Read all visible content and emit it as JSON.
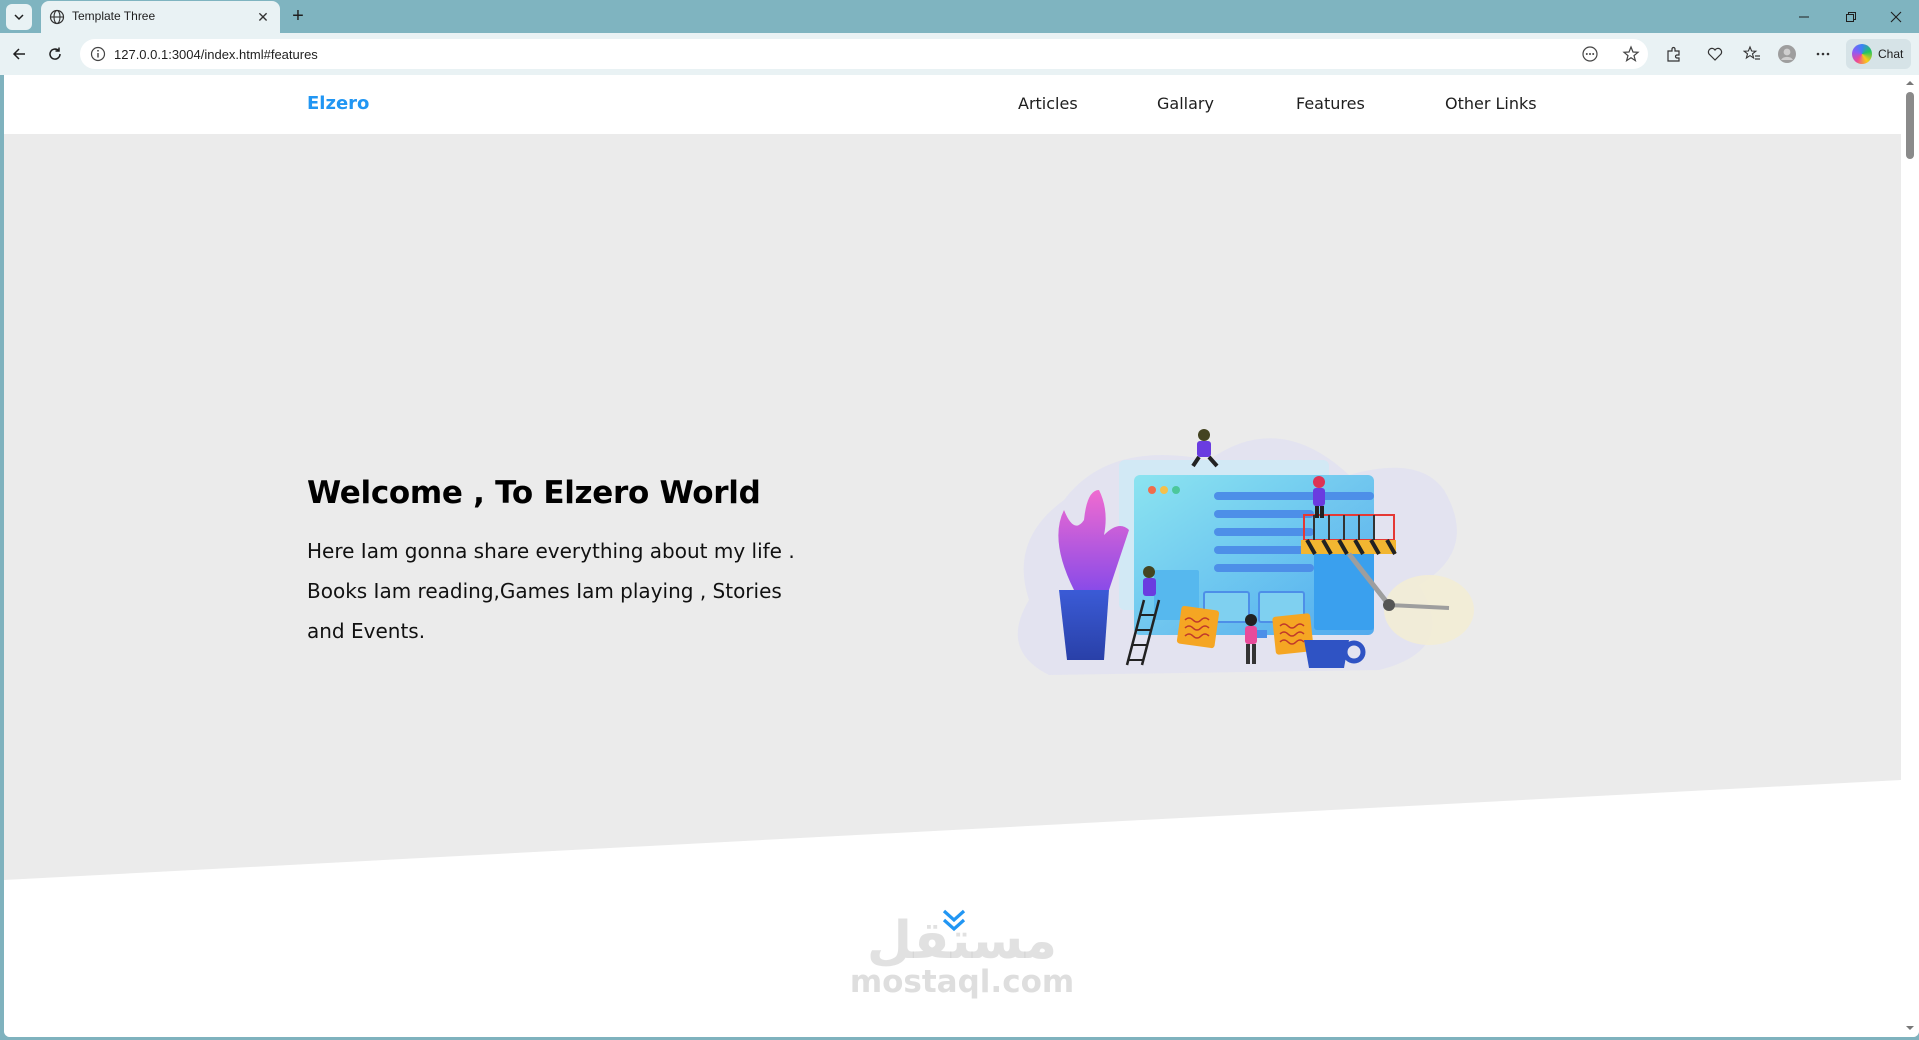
{
  "browser": {
    "tab_title": "Template Three",
    "url": "127.0.0.1:3004/index.html#features",
    "chat_label": "Chat"
  },
  "page": {
    "logo": "Elzero",
    "nav": [
      {
        "label": "Articles"
      },
      {
        "label": "Gallary"
      },
      {
        "label": "Features"
      },
      {
        "label": "Other Links"
      }
    ],
    "hero": {
      "title": "Welcome , To Elzero World",
      "text": "Here Iam gonna share everything about my life . Books Iam reading,Games Iam playing , Stories and Events."
    },
    "watermark": {
      "arabic": "مستقل",
      "latin": "mostaql.com"
    }
  },
  "colors": {
    "accent": "#2196f3",
    "hero_bg": "#ebebeb",
    "header_bg": "#ffffff",
    "chrome_bg": "#7fb4c0"
  }
}
